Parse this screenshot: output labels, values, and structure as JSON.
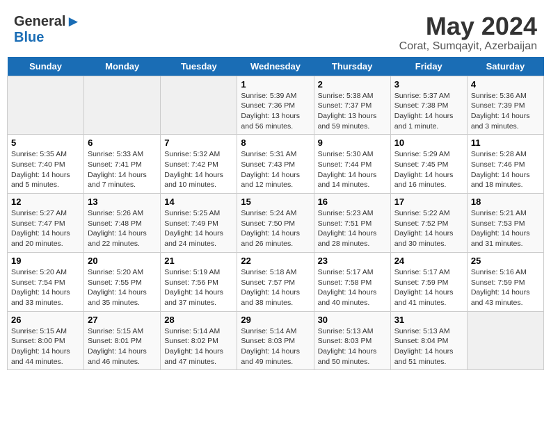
{
  "logo": {
    "general": "General",
    "blue": "Blue"
  },
  "title": "May 2024",
  "subtitle": "Corat, Sumqayit, Azerbaijan",
  "days_of_week": [
    "Sunday",
    "Monday",
    "Tuesday",
    "Wednesday",
    "Thursday",
    "Friday",
    "Saturday"
  ],
  "weeks": [
    [
      {
        "num": "",
        "info": ""
      },
      {
        "num": "",
        "info": ""
      },
      {
        "num": "",
        "info": ""
      },
      {
        "num": "1",
        "info": "Sunrise: 5:39 AM\nSunset: 7:36 PM\nDaylight: 13 hours\nand 56 minutes."
      },
      {
        "num": "2",
        "info": "Sunrise: 5:38 AM\nSunset: 7:37 PM\nDaylight: 13 hours\nand 59 minutes."
      },
      {
        "num": "3",
        "info": "Sunrise: 5:37 AM\nSunset: 7:38 PM\nDaylight: 14 hours\nand 1 minute."
      },
      {
        "num": "4",
        "info": "Sunrise: 5:36 AM\nSunset: 7:39 PM\nDaylight: 14 hours\nand 3 minutes."
      }
    ],
    [
      {
        "num": "5",
        "info": "Sunrise: 5:35 AM\nSunset: 7:40 PM\nDaylight: 14 hours\nand 5 minutes."
      },
      {
        "num": "6",
        "info": "Sunrise: 5:33 AM\nSunset: 7:41 PM\nDaylight: 14 hours\nand 7 minutes."
      },
      {
        "num": "7",
        "info": "Sunrise: 5:32 AM\nSunset: 7:42 PM\nDaylight: 14 hours\nand 10 minutes."
      },
      {
        "num": "8",
        "info": "Sunrise: 5:31 AM\nSunset: 7:43 PM\nDaylight: 14 hours\nand 12 minutes."
      },
      {
        "num": "9",
        "info": "Sunrise: 5:30 AM\nSunset: 7:44 PM\nDaylight: 14 hours\nand 14 minutes."
      },
      {
        "num": "10",
        "info": "Sunrise: 5:29 AM\nSunset: 7:45 PM\nDaylight: 14 hours\nand 16 minutes."
      },
      {
        "num": "11",
        "info": "Sunrise: 5:28 AM\nSunset: 7:46 PM\nDaylight: 14 hours\nand 18 minutes."
      }
    ],
    [
      {
        "num": "12",
        "info": "Sunrise: 5:27 AM\nSunset: 7:47 PM\nDaylight: 14 hours\nand 20 minutes."
      },
      {
        "num": "13",
        "info": "Sunrise: 5:26 AM\nSunset: 7:48 PM\nDaylight: 14 hours\nand 22 minutes."
      },
      {
        "num": "14",
        "info": "Sunrise: 5:25 AM\nSunset: 7:49 PM\nDaylight: 14 hours\nand 24 minutes."
      },
      {
        "num": "15",
        "info": "Sunrise: 5:24 AM\nSunset: 7:50 PM\nDaylight: 14 hours\nand 26 minutes."
      },
      {
        "num": "16",
        "info": "Sunrise: 5:23 AM\nSunset: 7:51 PM\nDaylight: 14 hours\nand 28 minutes."
      },
      {
        "num": "17",
        "info": "Sunrise: 5:22 AM\nSunset: 7:52 PM\nDaylight: 14 hours\nand 30 minutes."
      },
      {
        "num": "18",
        "info": "Sunrise: 5:21 AM\nSunset: 7:53 PM\nDaylight: 14 hours\nand 31 minutes."
      }
    ],
    [
      {
        "num": "19",
        "info": "Sunrise: 5:20 AM\nSunset: 7:54 PM\nDaylight: 14 hours\nand 33 minutes."
      },
      {
        "num": "20",
        "info": "Sunrise: 5:20 AM\nSunset: 7:55 PM\nDaylight: 14 hours\nand 35 minutes."
      },
      {
        "num": "21",
        "info": "Sunrise: 5:19 AM\nSunset: 7:56 PM\nDaylight: 14 hours\nand 37 minutes."
      },
      {
        "num": "22",
        "info": "Sunrise: 5:18 AM\nSunset: 7:57 PM\nDaylight: 14 hours\nand 38 minutes."
      },
      {
        "num": "23",
        "info": "Sunrise: 5:17 AM\nSunset: 7:58 PM\nDaylight: 14 hours\nand 40 minutes."
      },
      {
        "num": "24",
        "info": "Sunrise: 5:17 AM\nSunset: 7:59 PM\nDaylight: 14 hours\nand 41 minutes."
      },
      {
        "num": "25",
        "info": "Sunrise: 5:16 AM\nSunset: 7:59 PM\nDaylight: 14 hours\nand 43 minutes."
      }
    ],
    [
      {
        "num": "26",
        "info": "Sunrise: 5:15 AM\nSunset: 8:00 PM\nDaylight: 14 hours\nand 44 minutes."
      },
      {
        "num": "27",
        "info": "Sunrise: 5:15 AM\nSunset: 8:01 PM\nDaylight: 14 hours\nand 46 minutes."
      },
      {
        "num": "28",
        "info": "Sunrise: 5:14 AM\nSunset: 8:02 PM\nDaylight: 14 hours\nand 47 minutes."
      },
      {
        "num": "29",
        "info": "Sunrise: 5:14 AM\nSunset: 8:03 PM\nDaylight: 14 hours\nand 49 minutes."
      },
      {
        "num": "30",
        "info": "Sunrise: 5:13 AM\nSunset: 8:03 PM\nDaylight: 14 hours\nand 50 minutes."
      },
      {
        "num": "31",
        "info": "Sunrise: 5:13 AM\nSunset: 8:04 PM\nDaylight: 14 hours\nand 51 minutes."
      },
      {
        "num": "",
        "info": ""
      }
    ]
  ]
}
